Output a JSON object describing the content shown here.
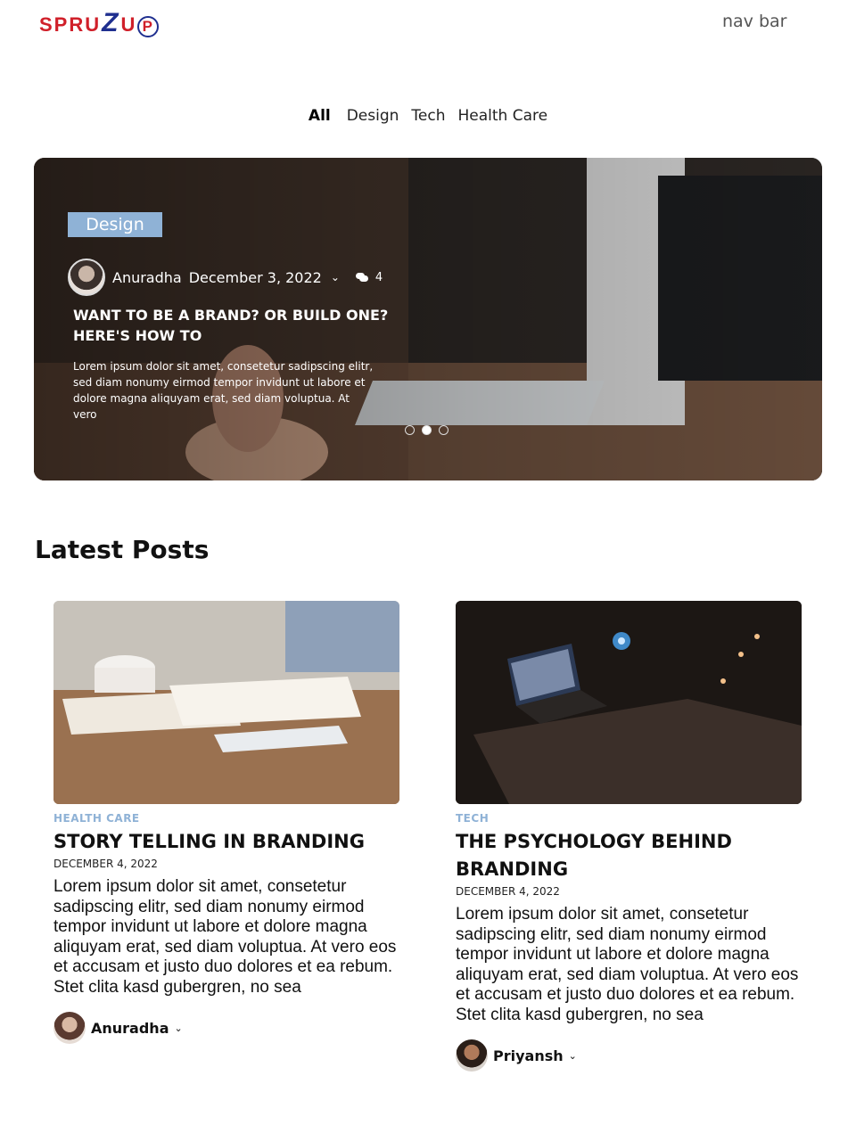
{
  "header": {
    "logo": "SPRUZUP",
    "nav_label": "nav bar"
  },
  "tabs": [
    {
      "label": "All",
      "active": true
    },
    {
      "label": "Design",
      "active": false
    },
    {
      "label": "Tech",
      "active": false
    },
    {
      "label": "Health Care",
      "active": false
    }
  ],
  "hero": {
    "category": "Design",
    "author": "Anuradha",
    "date": "December 3, 2022",
    "comments": "4",
    "title": "WANT TO BE A BRAND? OR BUILD ONE? HERE'S HOW TO",
    "excerpt": "Lorem ipsum dolor sit amet, consetetur sadipscing elitr, sed diam nonumy eirmod tempor invidunt ut labore et dolore magna aliquyam erat, sed diam voluptua. At vero",
    "slides": 3,
    "active_slide": 2
  },
  "latest": {
    "title": "Latest Posts",
    "posts": [
      {
        "category": "HEALTH CARE",
        "title": "STORY TELLING IN BRANDING",
        "date": "DECEMBER 4, 2022",
        "excerpt": "Lorem ipsum dolor sit amet, consetetur sadipscing elitr, sed diam nonumy eirmod tempor invidunt ut labore et dolore magna aliquyam erat, sed diam voluptua. At vero eos et accusam et justo duo dolores et ea rebum. Stet clita kasd gubergren, no sea",
        "author": "Anuradha"
      },
      {
        "category": "TECH",
        "title": "THE PSYCHOLOGY BEHIND BRANDING",
        "date": "DECEMBER 4, 2022",
        "excerpt": "Lorem ipsum dolor sit amet, consetetur sadipscing elitr, sed diam nonumy eirmod tempor invidunt ut labore et dolore magna aliquyam erat, sed diam voluptua. At vero eos et accusam et justo duo dolores et ea rebum. Stet clita kasd gubergren, no sea",
        "author": "Priyansh"
      }
    ]
  },
  "colors": {
    "accent": "#8fb2d6",
    "logo_red": "#d0202a",
    "logo_blue": "#1f2f8f"
  }
}
